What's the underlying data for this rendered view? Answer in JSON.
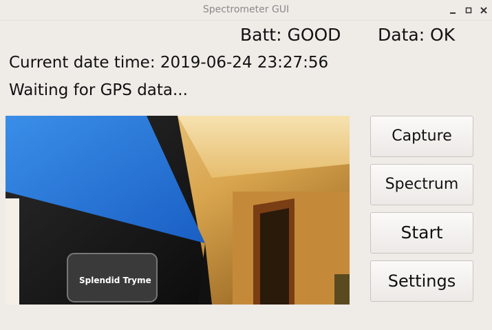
{
  "window": {
    "title": "Spectrometer GUI"
  },
  "status": {
    "battery": "Batt: GOOD",
    "data": "Data: OK"
  },
  "info": {
    "datetime": "Current date time: 2019-06-24 23:27:56",
    "gps": "Waiting for GPS data..."
  },
  "camera_feed": {
    "label_text": "Splendid Tryme"
  },
  "buttons": {
    "capture": "Capture",
    "spectrum": "Spectrum",
    "start": "Start",
    "settings": "Settings"
  }
}
